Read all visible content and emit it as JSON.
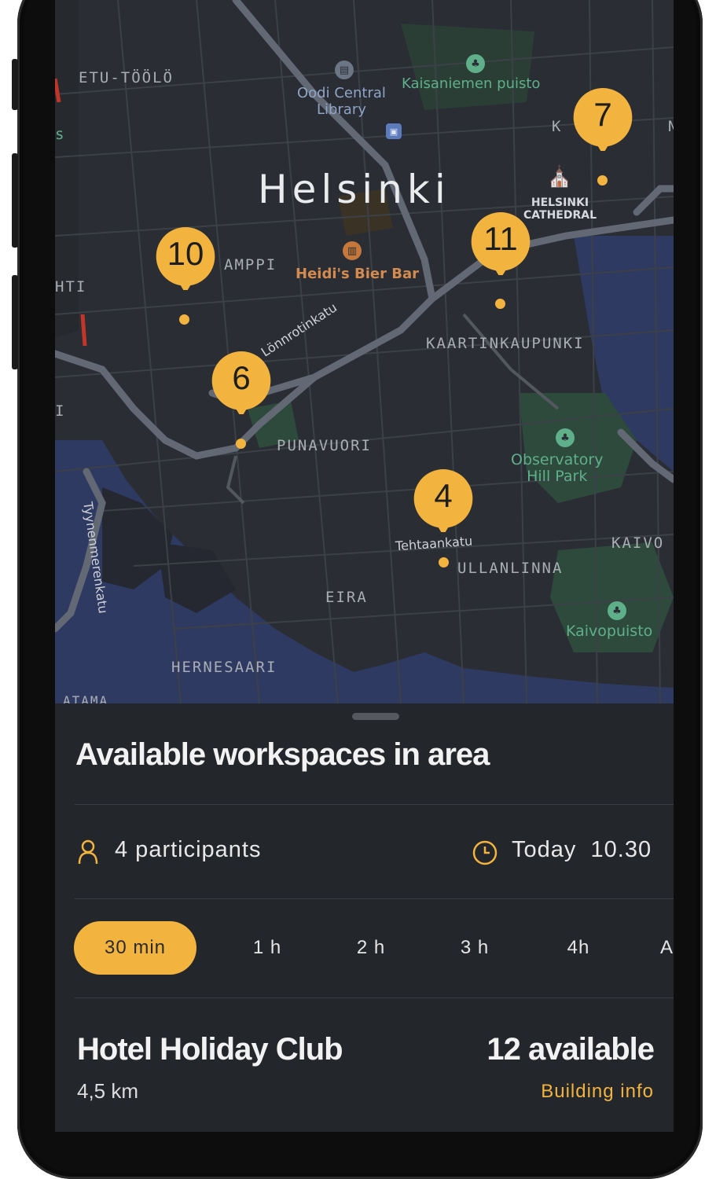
{
  "map": {
    "city": "Helsinki",
    "districts": [
      "ETU-TÖÖLÖ",
      "KAMPPI",
      "KAARTINKAUPUNKI",
      "PUNAVUORI",
      "ULLANLINNA",
      "EIRA",
      "HERNESAARI",
      "KAIVO",
      "KRUUNUNHA"
    ],
    "pois": {
      "library": "Oodi Central\nLibrary",
      "park1": "Kaisaniemen puisto",
      "cathedral": "HELSINKI\nCATHEDRAL",
      "bar": "Heidi's Bier Bar",
      "park2": "Observatory\nHill Park",
      "park3": "Kaivopuisto"
    },
    "streets": {
      "lonnrot": "Lönnrotinkatu",
      "tehtaan": "Tehtaankatu",
      "tyynen": "Tyynenmerenkatu"
    },
    "markers": [
      "7",
      "10",
      "11",
      "6",
      "4"
    ],
    "partial_labels": {
      "left1": "s",
      "left2": "HTI",
      "left3": "I",
      "bottom": "ATAMA"
    }
  },
  "sheet": {
    "title": "Available workspaces in area",
    "participants": "4 participants",
    "time": "Today  10.30",
    "durations": [
      "30 min",
      "1 h",
      "2 h",
      "3 h",
      "4h",
      "A"
    ],
    "venue": {
      "name": "Hotel Holiday Club",
      "distance": "4,5 km",
      "available": "12 available",
      "link": "Building info"
    }
  },
  "colors": {
    "accent": "#f3b43f",
    "sheet_bg": "#23262b",
    "map_bg": "#2a2d33",
    "water": "#2f3a63",
    "park": "#2d4a3c"
  }
}
